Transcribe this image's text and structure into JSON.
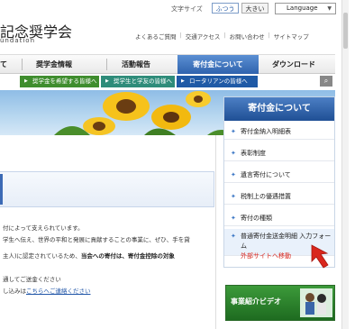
{
  "utility": {
    "font_size_label": "文字サイズ",
    "font_normal": "ふつう",
    "font_large": "大きい",
    "language": "Language"
  },
  "logo": {
    "title": "記念奨学会",
    "subtitle": "undation"
  },
  "header_links": [
    "よくあるご質問",
    "交通アクセス",
    "お問い合わせ",
    "サイトマップ"
  ],
  "nav": {
    "items": [
      "て",
      "奨学金情報",
      "活動報告",
      "寄付金について",
      "ダウンロード"
    ],
    "active_index": 3
  },
  "subnav": [
    "奨学金を希望する皆様へ",
    "奨学生と学友の皆様へ",
    "ロータリアンの皆様へ"
  ],
  "content": {
    "lines": [
      "付によって支えられています。",
      "学生へ伝え、世界の平和と発展に貢献することの事業に、ぜひ、手を貸",
      "主人)に認定されているため、当会への寄付は、寄付金控除の対象",
      "通してご送金ください",
      "し込みは",
      "こちらへご連絡ください"
    ],
    "bold_part": "当会への寄付は、寄付金控除の対象"
  },
  "sidebar": {
    "title": "寄付金について",
    "items": [
      "寄付金納入明細表",
      "表彰制度",
      "遺言寄付について",
      "税制上の優遇措置",
      "寄付の種類"
    ],
    "highlight_item": "普通寄付金送金明細 入力フォーム",
    "external_text": "外部サイトへ移動"
  },
  "video_banner": {
    "label": "事業紹介ビデオ"
  },
  "colors": {
    "nav_active": "#2f63ad",
    "sidebar_header": "#1f4f95",
    "subnav_green": "#3f8d2e",
    "subnav_teal": "#2e8c7a",
    "subnav_blue": "#1f5aa6",
    "arrow": "#d9261c",
    "video_green": "#1e6b20"
  }
}
